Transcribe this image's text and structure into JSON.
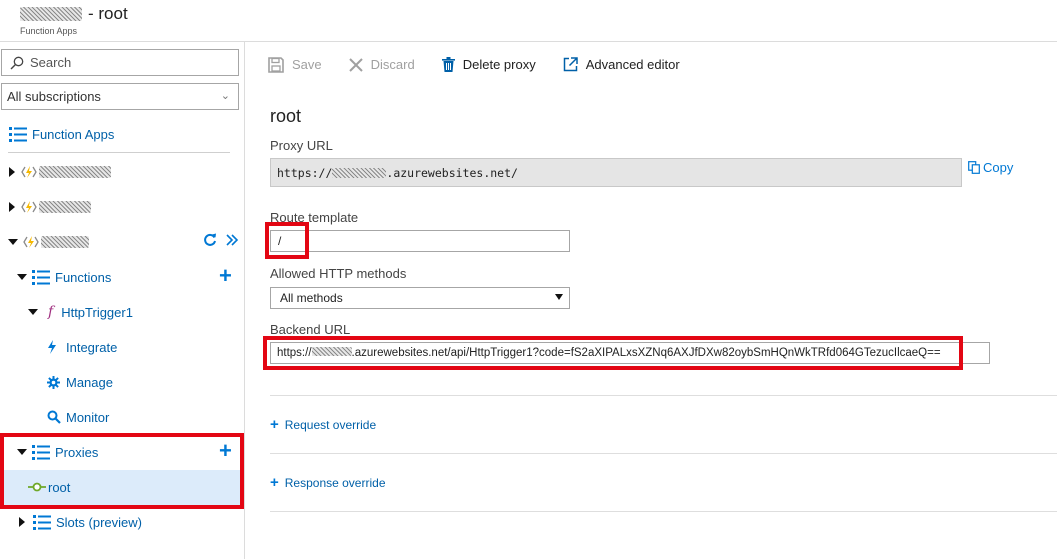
{
  "header": {
    "title_suffix": "- root",
    "subtitle": "Function Apps"
  },
  "sidebar": {
    "search_placeholder": "Search",
    "subscriptions": "All subscriptions",
    "function_apps_label": "Function Apps",
    "functions_label": "Functions",
    "trigger_label": "HttpTrigger1",
    "integrate_label": "Integrate",
    "manage_label": "Manage",
    "monitor_label": "Monitor",
    "proxies_label": "Proxies",
    "root_label": "root",
    "slots_label": "Slots (preview)"
  },
  "toolbar": {
    "save_label": "Save",
    "discard_label": "Discard",
    "delete_label": "Delete proxy",
    "advanced_label": "Advanced editor"
  },
  "main": {
    "title": "root",
    "proxy_url_label": "Proxy URL",
    "proxy_url_prefix": "https://",
    "proxy_url_suffix": ".azurewebsites.net/",
    "copy_label": "Copy",
    "route_label": "Route template",
    "route_value": "/",
    "methods_label": "Allowed HTTP methods",
    "methods_value": "All methods",
    "backend_label": "Backend URL",
    "backend_prefix": "https://",
    "backend_suffix": ".azurewebsites.net/api/HttpTrigger1?code=fS2aXIPALxsXZNq6AXJfDXw82oybSmHQnWkTRfd064GTezucIlcaeQ==",
    "request_override": "Request override",
    "response_override": "Response override"
  },
  "colors": {
    "accent": "#0078d4",
    "link": "#0060a8",
    "highlight": "#e30613",
    "selected": "#dcebfa",
    "function_icon": "#f5b800"
  }
}
